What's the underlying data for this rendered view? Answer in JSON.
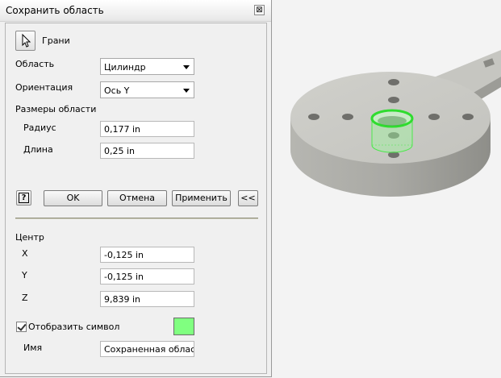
{
  "window": {
    "title": "Сохранить область",
    "close_glyph": "⊠"
  },
  "faces": {
    "label": "Грани"
  },
  "area": {
    "label": "Область",
    "value": "Цилиндр"
  },
  "orientation": {
    "label": "Ориентация",
    "value": "Ось Y"
  },
  "size_group": {
    "label": "Размеры области",
    "radius_label": "Радиус",
    "radius_value": "0,177 in",
    "length_label": "Длина",
    "length_value": "0,25 in"
  },
  "buttons": {
    "help": "?",
    "ok": "OK",
    "cancel": "Отмена",
    "apply": "Применить",
    "collapse": "<<"
  },
  "center": {
    "label": "Центр",
    "x_label": "X",
    "x_value": "-0,125 in",
    "y_label": "Y",
    "y_value": "-0,125 in",
    "z_label": "Z",
    "z_value": "9,839 in"
  },
  "display_symbol": {
    "label": "Отобразить символ",
    "checked": true,
    "color": "#80ff80"
  },
  "name": {
    "label": "Имя",
    "value": "Сохраненная область"
  },
  "colors": {
    "model_gray": "#c2c2bd",
    "highlight_green": "#4ce84c"
  },
  "icons": {
    "cursor": "arrow-cursor-icon",
    "help": "help-icon",
    "dropdown": "chevron-down-icon"
  }
}
